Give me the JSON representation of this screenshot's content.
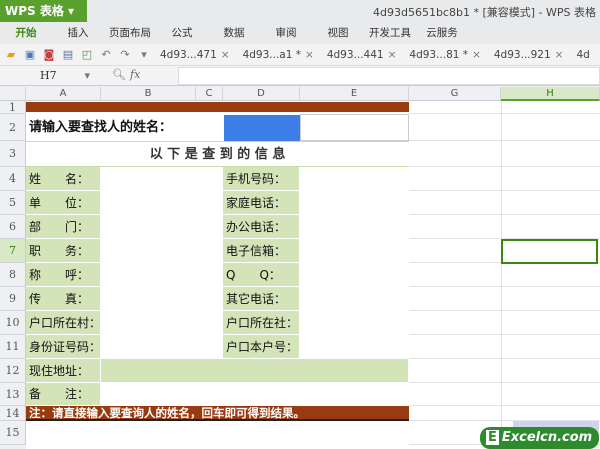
{
  "app": {
    "logo": "WPS 表格",
    "title": "4d93d5651bc8b1 * [兼容模式] - WPS 表格"
  },
  "menu": [
    "开始",
    "插入",
    "页面布局",
    "公式",
    "数据",
    "审阅",
    "视图",
    "开发工具",
    "云服务"
  ],
  "doc_tabs": [
    "4d93...471",
    "4d93...a1 *",
    "4d93...441",
    "4d93...81 *",
    "4d93...921",
    "4d"
  ],
  "formula_bar": {
    "cell_ref": "H7",
    "fx": "fx",
    "value": ""
  },
  "columns": [
    "A",
    "B",
    "C",
    "D",
    "E",
    "G",
    "H"
  ],
  "rows": [
    "1",
    "2",
    "3",
    "4",
    "5",
    "6",
    "7",
    "8",
    "9",
    "10",
    "11",
    "12",
    "13",
    "14",
    "15"
  ],
  "sheet": {
    "prompt": "请输入要查找人的姓名：",
    "header": "以 下 是 查 到 的 信 息",
    "left_labels": [
      "姓　　名：",
      "单　　位：",
      "部　　门：",
      "职　　务：",
      "称　　呼：",
      "传　　真：",
      "户口所在村：",
      "身份证号码：",
      "现住地址：",
      "备　　注："
    ],
    "right_labels": [
      "手机号码：",
      "家庭电话：",
      "办公电话：",
      "电子信箱：",
      "Q　　Q：",
      "其它电话：",
      "户口所在社：",
      "户口本户号："
    ],
    "note": "注：请直接输入要查询人的姓名，回车即可得到结果。"
  },
  "watermark": "Excelcn.com"
}
